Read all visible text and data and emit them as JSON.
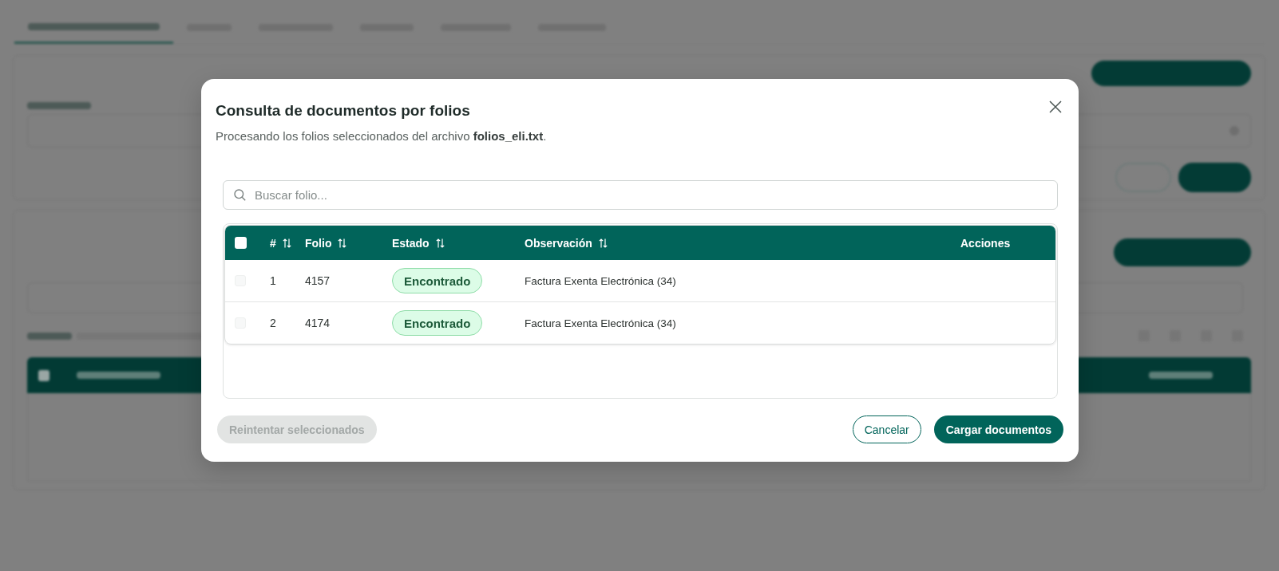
{
  "dialog": {
    "title": "Consulta de documentos por folios",
    "description": "Procesando los folios seleccionados del archivo **folios_eli.txt**."
  },
  "search": {
    "placeholder": "Buscar folio..."
  },
  "table": {
    "select_all": {
      "checked": false
    },
    "columns": [
      {
        "label": "#",
        "sortable": true
      },
      {
        "label": "Folio",
        "sortable": true
      },
      {
        "label": "Estado",
        "sortable": true
      },
      {
        "label": "Observación",
        "sortable": true
      },
      {
        "label": "Acciones",
        "sortable": false
      }
    ],
    "rows": [
      {
        "checked": false,
        "disabled": true,
        "number": "1",
        "folio": "4157",
        "status": {
          "label": "Encontrado",
          "kind": "found"
        },
        "observation": "Factura Exenta Electrónica (34)"
      },
      {
        "checked": false,
        "disabled": true,
        "number": "2",
        "folio": "4174",
        "status": {
          "label": "Encontrado",
          "kind": "found"
        },
        "observation": "Factura Exenta Electrónica (34)"
      }
    ]
  },
  "footer": {
    "retry_button": {
      "label": "Reintentar seleccionados",
      "disabled": true
    },
    "actions": [
      {
        "label": "Cancelar",
        "kind": "outline"
      },
      {
        "label": "Cargar documentos",
        "kind": "primary"
      }
    ]
  }
}
